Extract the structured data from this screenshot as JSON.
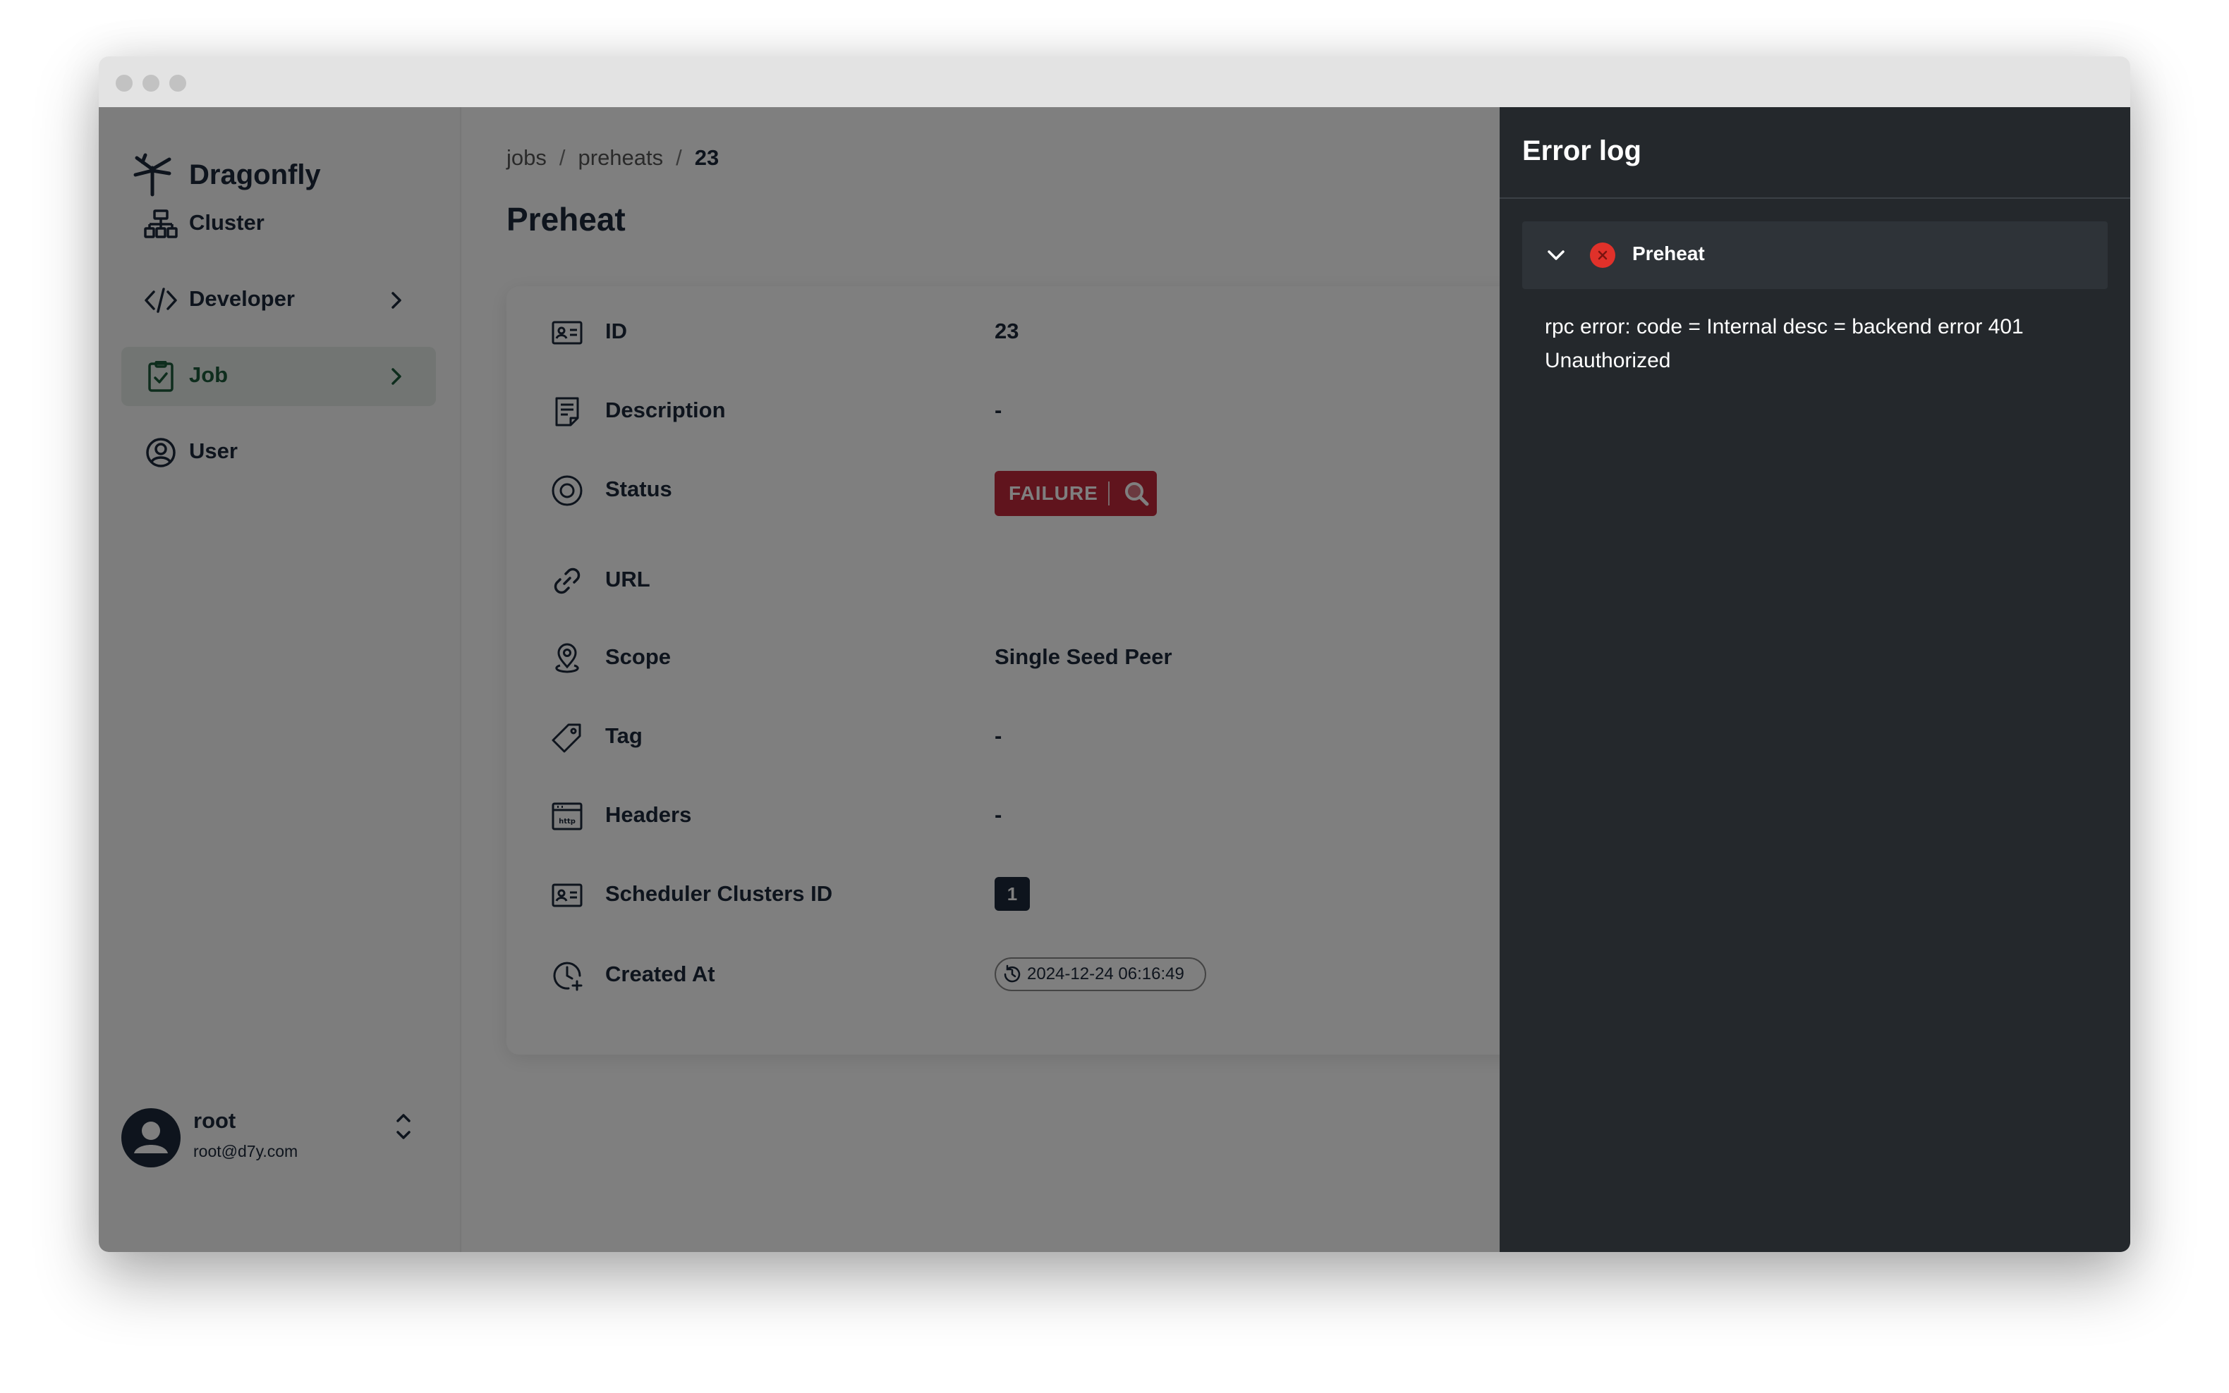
{
  "app": {
    "name": "Dragonfly"
  },
  "sidebar": {
    "items": [
      {
        "label": "Cluster",
        "icon": "cluster-icon",
        "active": false
      },
      {
        "label": "Developer",
        "icon": "code-icon",
        "active": false
      },
      {
        "label": "Job",
        "icon": "clipboard-check-icon",
        "active": true
      },
      {
        "label": "User",
        "icon": "user-circle-icon",
        "active": false
      }
    ],
    "user": {
      "name": "root",
      "email": "root@d7y.com"
    }
  },
  "breadcrumb": [
    "jobs",
    "preheats",
    "23"
  ],
  "page": {
    "title": "Preheat"
  },
  "details": {
    "id": {
      "label": "ID",
      "value": "23"
    },
    "description": {
      "label": "Description",
      "value": "-"
    },
    "status": {
      "label": "Status",
      "value": "FAILURE",
      "color": "#c0283a"
    },
    "url": {
      "label": "URL",
      "value": ""
    },
    "scope": {
      "label": "Scope",
      "value": "Single Seed Peer"
    },
    "tag": {
      "label": "Tag",
      "value": "-"
    },
    "headers": {
      "label": "Headers",
      "value": "-"
    },
    "scheduler_clusters": {
      "label": "Scheduler Clusters ID",
      "value": "1"
    },
    "created_at": {
      "label": "Created At",
      "value": "2024-12-24 06:16:49"
    }
  },
  "error_log": {
    "title": "Error log",
    "entry": {
      "title": "Preheat",
      "message": "rpc error: code = Internal desc = backend error 401 Unauthorized"
    }
  },
  "colors": {
    "accent": "#1c5a3a",
    "failure": "#c0283a",
    "drawer_bg": "#24282c",
    "text": "#1c293a"
  }
}
